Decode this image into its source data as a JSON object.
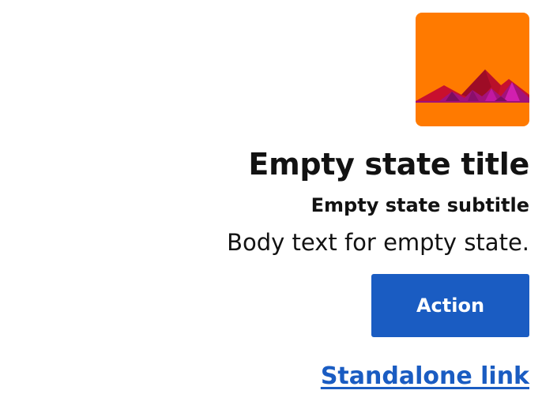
{
  "empty_state": {
    "illustration_icon": "mountain-landscape-icon",
    "title": "Empty state title",
    "subtitle": "Empty state subtitle",
    "body": "Body text for empty state.",
    "action_label": "Action",
    "link_label": "Standalone link"
  },
  "colors": {
    "illustration_background": "#ff7a00",
    "primary_button": "#1a5cc2",
    "link": "#1a5cc2",
    "text": "#121212"
  }
}
